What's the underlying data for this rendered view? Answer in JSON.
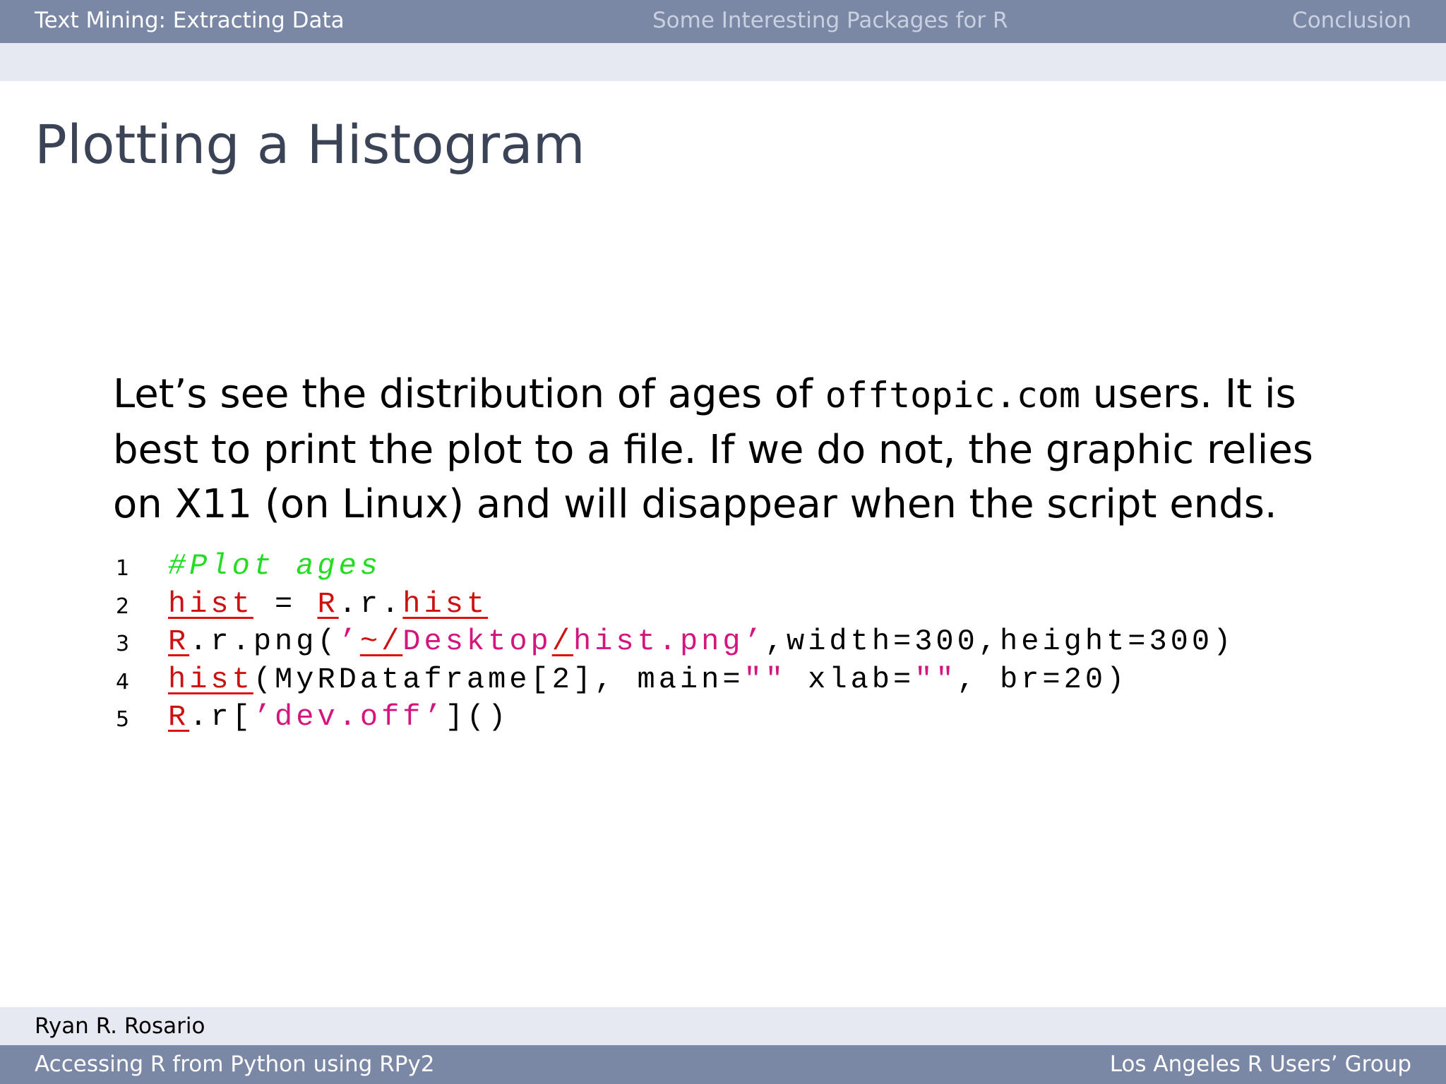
{
  "nav": {
    "sections": [
      {
        "label": "Text Mining: Extracting Data",
        "active": true
      },
      {
        "label": "Some Interesting Packages for R",
        "active": false
      },
      {
        "label": "Conclusion",
        "active": false
      }
    ]
  },
  "frame": {
    "title": "Plotting a Histogram"
  },
  "body": {
    "text_before": "Let’s see the distribution of ages of ",
    "inline_code": "offtopic.com",
    "text_after": " users. It is best to print the plot to a file. If we do not, the graphic relies on X11 (on Linux) and will disappear when the script ends."
  },
  "code": {
    "line_numbers": [
      "1",
      "2",
      "3",
      "4",
      "5"
    ],
    "lines": {
      "l1": {
        "comment": "#Plot ages"
      },
      "l2": {
        "a": "hist",
        "b": " = ",
        "c": "R",
        "d": ".r.",
        "e": "hist"
      },
      "l3": {
        "a": "R",
        "b": ".r.png(",
        "c": "’",
        "d": "~/",
        "e": "Desktop",
        "f": "/",
        "g": "hist.png’",
        "h": ",width=300,height=300)"
      },
      "l4": {
        "a": "hist",
        "b": "(MyRDataframe[2], main=",
        "c": "\"\"",
        "d": " xlab=",
        "e": "\"\"",
        "f": ", br=20)"
      },
      "l5": {
        "a": "R",
        "b": ".r[",
        "c": "’dev.off’",
        "d": "]()"
      }
    }
  },
  "footer": {
    "author": "Ryan R. Rosario",
    "talk_title": "Accessing R from Python using RPy2",
    "venue": "Los Angeles R Users’ Group"
  },
  "colors": {
    "bar": "#7a88a6",
    "subbar": "#e6e9f1",
    "title": "#3b4356",
    "comment": "#22dd22",
    "string": "#d4157e",
    "error_underline": "#e01010"
  }
}
